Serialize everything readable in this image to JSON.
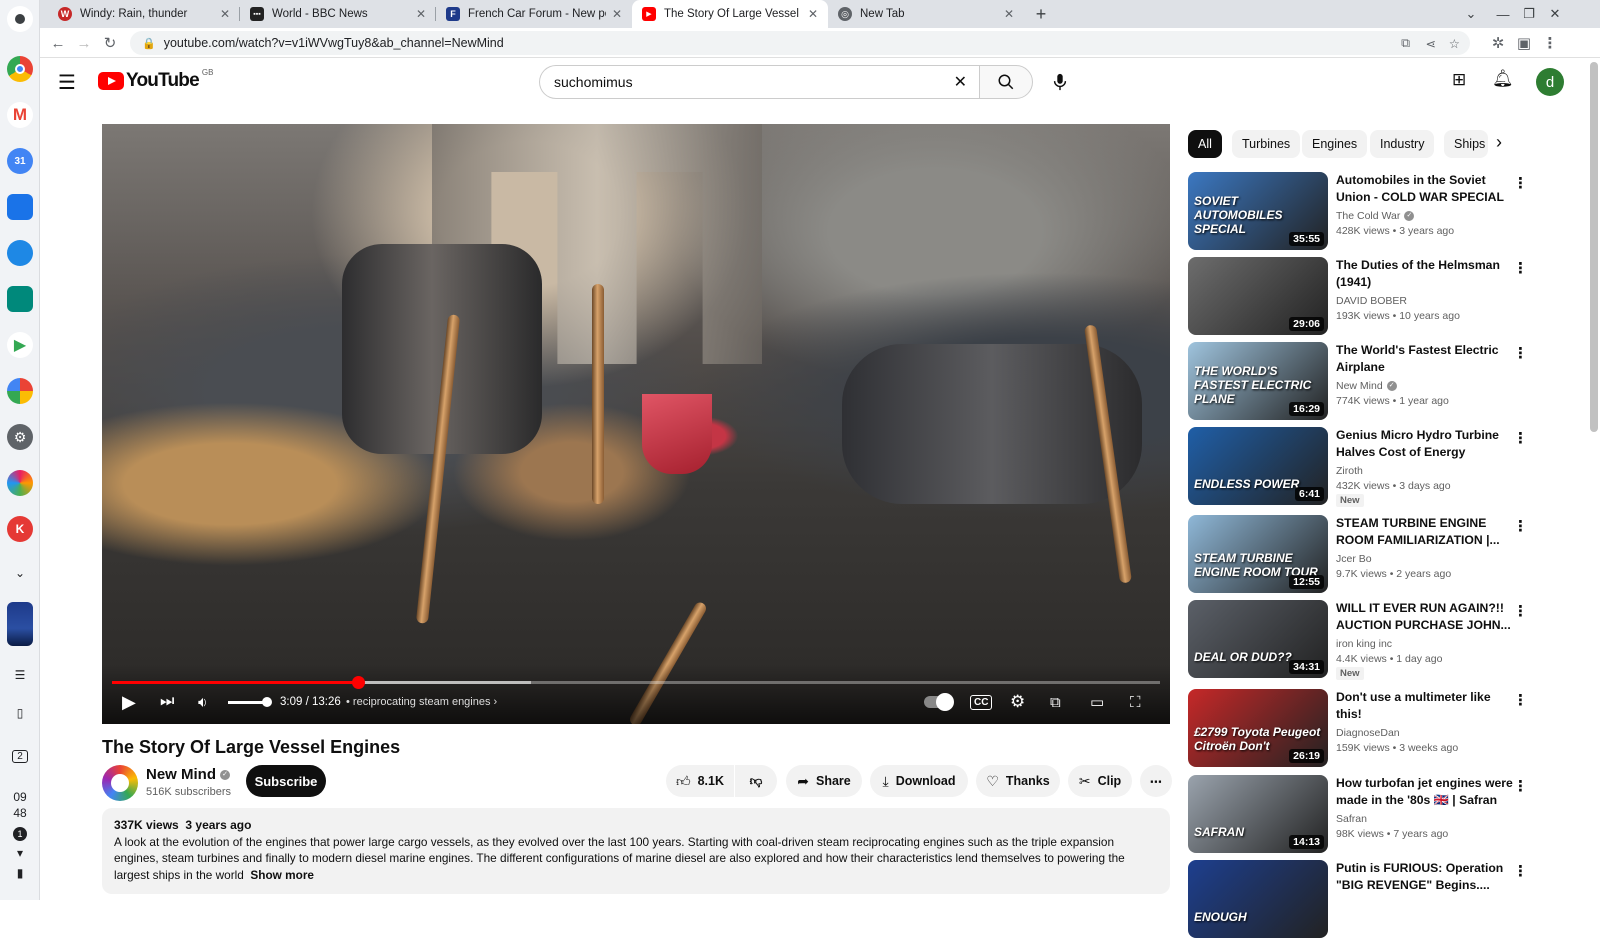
{
  "browser": {
    "tabs": [
      {
        "title": "Windy: Rain, thunder",
        "active": false
      },
      {
        "title": "World - BBC News",
        "active": false
      },
      {
        "title": "French Car Forum - New posts",
        "active": false
      },
      {
        "title": "The Story Of Large Vessel Engin",
        "active": true
      },
      {
        "title": "New Tab",
        "active": false
      }
    ],
    "url": "youtube.com/watch?v=v1iWVwgTuy8&ab_channel=NewMind"
  },
  "shelf": {
    "time_hours": "09",
    "time_minutes": "48",
    "desk_number": "2",
    "notification_count": "1"
  },
  "youtube": {
    "logo_text": "YouTube",
    "country_code": "GB",
    "search_query": "suchomimus",
    "avatar_letter": "d"
  },
  "player": {
    "time_current": "3:09",
    "time_total": "13:26",
    "time_separator": "/",
    "chapter": "• reciprocating steam engines",
    "progress_fraction": 0.235,
    "buffered_fraction": 0.4
  },
  "video": {
    "title": "The Story Of Large Vessel Engines",
    "channel": "New Mind",
    "subscribers": "516K subscribers",
    "subscribe_label": "Subscribe",
    "likes": "8.1K",
    "share_label": "Share",
    "download_label": "Download",
    "thanks_label": "Thanks",
    "clip_label": "Clip",
    "views": "337K views",
    "age": "3 years ago",
    "description": "A look at the evolution of the engines that power large cargo vessels, as they evolved over the last 100 years. Starting with coal-driven steam reciprocating engines such as the triple expansion engines, steam turbines and finally to modern diesel marine engines.  The different configurations of marine diesel are also explored and how their characteristics lend themselves to powering the largest ships in the world",
    "show_more": "Show more"
  },
  "chips": [
    "All",
    "Turbines",
    "Engines",
    "Industry",
    "Ships"
  ],
  "recommended": [
    {
      "title": "Automobiles in the Soviet Union - COLD WAR SPECIAL",
      "channel": "The Cold War",
      "verified": true,
      "views": "428K views",
      "age": "3 years ago",
      "duration": "35:55",
      "badge": "",
      "thumb_text": "SOVIET AUTOMOBILES SPECIAL",
      "thumb_color": "#3b78c2"
    },
    {
      "title": "The Duties of the Helmsman (1941)",
      "channel": "DAVID BOBER",
      "verified": false,
      "views": "193K views",
      "age": "10 years ago",
      "duration": "29:06",
      "badge": "",
      "thumb_text": "",
      "thumb_color": "#6d6d6d"
    },
    {
      "title": "The World's Fastest Electric Airplane",
      "channel": "New Mind",
      "verified": true,
      "views": "774K views",
      "age": "1 year ago",
      "duration": "16:29",
      "badge": "",
      "thumb_text": "THE WORLD'S FASTEST ELECTRIC PLANE",
      "thumb_color": "#9fc4de"
    },
    {
      "title": "Genius Micro Hydro Turbine Halves Cost of Energy",
      "channel": "Ziroth",
      "verified": false,
      "views": "432K views",
      "age": "3 days ago",
      "duration": "6:41",
      "badge": "New",
      "thumb_text": "ENDLESS POWER",
      "thumb_color": "#1f5fa8"
    },
    {
      "title": "STEAM TURBINE ENGINE ROOM FAMILIARIZATION |...",
      "channel": "Jcer Bo",
      "verified": false,
      "views": "9.7K views",
      "age": "2 years ago",
      "duration": "12:55",
      "badge": "",
      "thumb_text": "STEAM TURBINE ENGINE ROOM TOUR",
      "thumb_color": "#8fb8d8"
    },
    {
      "title": "WILL IT EVER RUN AGAIN?!! AUCTION PURCHASE JOHN...",
      "channel": "iron king inc",
      "verified": false,
      "views": "4.4K views",
      "age": "1 day ago",
      "duration": "34:31",
      "badge": "New",
      "thumb_text": "DEAL OR DUD??",
      "thumb_color": "#5b6068"
    },
    {
      "title": "Don't use a multimeter like this!",
      "channel": "DiagnoseDan",
      "verified": false,
      "views": "159K views",
      "age": "3 weeks ago",
      "duration": "26:19",
      "badge": "",
      "thumb_text": "£2799 Toyota Peugeot Citroën Don't",
      "thumb_color": "#c62828"
    },
    {
      "title": "How turbofan jet engines were made in the '80s 🇬🇧 | Safran",
      "channel": "Safran",
      "verified": false,
      "views": "98K views",
      "age": "7 years ago",
      "duration": "14:13",
      "badge": "",
      "thumb_text": "SAFRAN",
      "thumb_color": "#9aa3ad"
    },
    {
      "title": "Putin is FURIOUS: Operation \"BIG REVENGE\" Begins....",
      "channel": "",
      "verified": false,
      "views": "",
      "age": "",
      "duration": "",
      "badge": "",
      "thumb_text": "ENOUGH",
      "thumb_color": "#1d3f8f"
    }
  ]
}
